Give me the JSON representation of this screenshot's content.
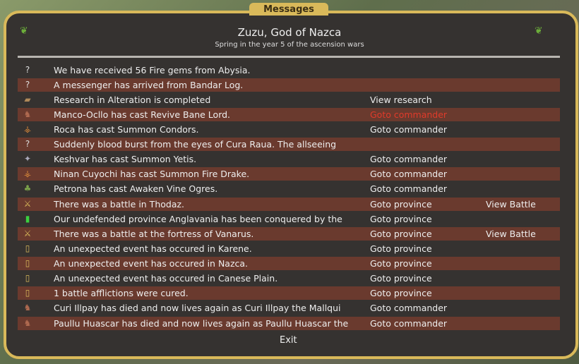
{
  "window": {
    "tab_title": "Messages",
    "title": "Zuzu, God of Nazca",
    "subtitle": "Spring in the year 5 of the ascension wars",
    "exit_label": "Exit"
  },
  "colors": {
    "frame": "#d9b95a",
    "highlight_row": "#6a3a2e",
    "active_link": "#e03a2a"
  },
  "messages": [
    {
      "icon": "question-icon",
      "text": "We have received 56 Fire gems from Abysia.",
      "link1": "",
      "link2": ""
    },
    {
      "icon": "question-icon",
      "text": "A messenger has arrived from Bandar Log.",
      "link1": "",
      "link2": ""
    },
    {
      "icon": "research-book-icon",
      "text": "Research in Alteration is completed",
      "link1": "View research",
      "link2": ""
    },
    {
      "icon": "commander-icon",
      "text": "Manco-Ocllo has cast Revive Bane Lord.",
      "link1": "Goto commander",
      "link2": "",
      "active": true
    },
    {
      "icon": "condor-icon",
      "text": "Roca has cast Summon Condors.",
      "link1": "Goto commander",
      "link2": ""
    },
    {
      "icon": "question-icon",
      "text": "Suddenly blood burst from the eyes of Cura Raua. The allseeing",
      "link1": "",
      "link2": ""
    },
    {
      "icon": "yeti-icon",
      "text": "Keshvar has cast Summon Yetis.",
      "link1": "Goto commander",
      "link2": ""
    },
    {
      "icon": "drake-icon",
      "text": "Ninan Cuyochi has cast Summon Fire Drake.",
      "link1": "Goto commander",
      "link2": ""
    },
    {
      "icon": "vine-icon",
      "text": "Petrona has cast Awaken Vine Ogres.",
      "link1": "Goto commander",
      "link2": ""
    },
    {
      "icon": "battle-icon",
      "text": "There was a battle in Thodaz.",
      "link1": "Goto province",
      "link2": "View Battle"
    },
    {
      "icon": "green-banner-icon",
      "text": "Our undefended province Anglavania has been conquered by the",
      "link1": "Goto province",
      "link2": ""
    },
    {
      "icon": "battle-icon",
      "text": "There was a battle at the fortress of Vanarus.",
      "link1": "Goto province",
      "link2": "View Battle"
    },
    {
      "icon": "banner-icon",
      "text": "An unexpected event has occured in Karene.",
      "link1": "Goto province",
      "link2": ""
    },
    {
      "icon": "banner-icon",
      "text": "An unexpected event has occured in Nazca.",
      "link1": "Goto province",
      "link2": ""
    },
    {
      "icon": "banner-icon",
      "text": "An unexpected event has occured in Canese Plain.",
      "link1": "Goto province",
      "link2": ""
    },
    {
      "icon": "banner-icon",
      "text": "1 battle afflictions were cured.",
      "link1": "Goto province",
      "link2": ""
    },
    {
      "icon": "commander-icon",
      "text": "Curi Illpay has died and now lives again as Curi Illpay the Mallqui",
      "link1": "Goto commander",
      "link2": ""
    },
    {
      "icon": "commander-icon",
      "text": "Paullu Huascar has died and now lives again as Paullu Huascar the",
      "link1": "Goto commander",
      "link2": ""
    }
  ]
}
